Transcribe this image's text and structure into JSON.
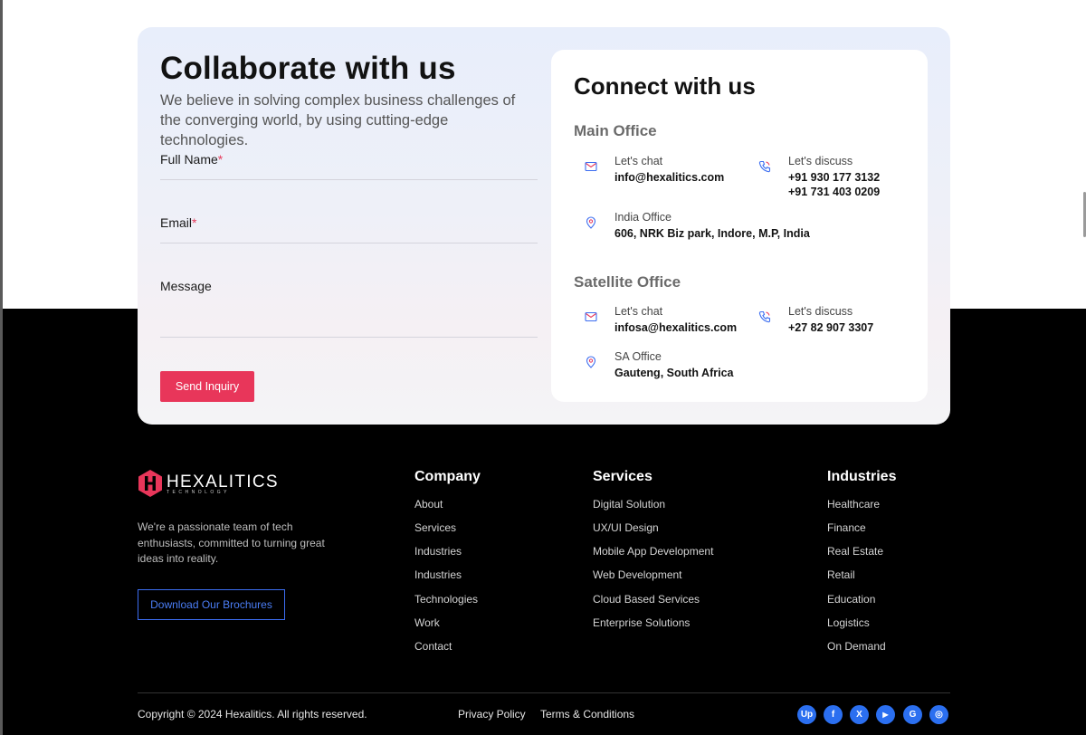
{
  "contact": {
    "title": "Collaborate with us",
    "subtitle": "We believe in solving complex business challenges of the converging world, by using cutting-edge technologies.",
    "fields": [
      {
        "label": "Full Name",
        "required": "*"
      },
      {
        "label": "Email",
        "required": "*"
      },
      {
        "label": "Message",
        "required": ""
      }
    ],
    "send_button": "Send Inquiry"
  },
  "connect": {
    "title": "Connect with us",
    "main_office": {
      "title": "Main Office",
      "chat_label": "Let's chat",
      "chat_value": "info@hexalitics.com",
      "discuss_label": "Let's discuss",
      "phone1": "+91 930 177 3132",
      "phone2": "+91 731 403 0209",
      "office_label": "India Office",
      "office_value": "606, NRK Biz park, Indore, M.P, India"
    },
    "satellite_office": {
      "title": "Satellite Office",
      "chat_label": "Let's chat",
      "chat_value": "infosa@hexalitics.com",
      "discuss_label": "Let's discuss",
      "phone1": "+27 82 907 3307",
      "office_label": "SA Office",
      "office_value": "Gauteng, South Africa"
    }
  },
  "footer": {
    "logo_text": "HEXALITICS",
    "logo_sub": "TECHNOLOGY",
    "about": "We're a passionate team of tech enthusiasts, committed to turning great ideas into reality.",
    "brochure_button": "Download Our Brochures",
    "company": {
      "title": "Company",
      "items": [
        "About",
        "Services",
        "Industries",
        "Industries",
        "Technologies",
        "Work",
        "Contact"
      ]
    },
    "services": {
      "title": "Services",
      "items": [
        "Digital Solution",
        "UX/UI Design",
        "Mobile App Development",
        "Web Development",
        "Cloud Based Services",
        "Enterprise Solutions"
      ]
    },
    "industries": {
      "title": "Industries",
      "items": [
        "Healthcare",
        "Finance",
        "Real Estate",
        "Retail",
        "Education",
        "Logistics",
        "On Demand"
      ]
    },
    "copyright": "Copyright © 2024 Hexalitics. All rights reserved.",
    "privacy": "Privacy Policy",
    "terms": "Terms & Conditions",
    "social": [
      {
        "icon": "upwork-icon",
        "glyph": "Up"
      },
      {
        "icon": "facebook-icon",
        "glyph": "f"
      },
      {
        "icon": "x-twitter-icon",
        "glyph": "X"
      },
      {
        "icon": "youtube-icon",
        "glyph": "▶"
      },
      {
        "icon": "google-icon",
        "glyph": "G"
      },
      {
        "icon": "instagram-icon",
        "glyph": "◎"
      }
    ]
  },
  "colors": {
    "accent": "#e8365a",
    "link_blue": "#2b6ff0",
    "icon_blue": "#3c6df0"
  }
}
